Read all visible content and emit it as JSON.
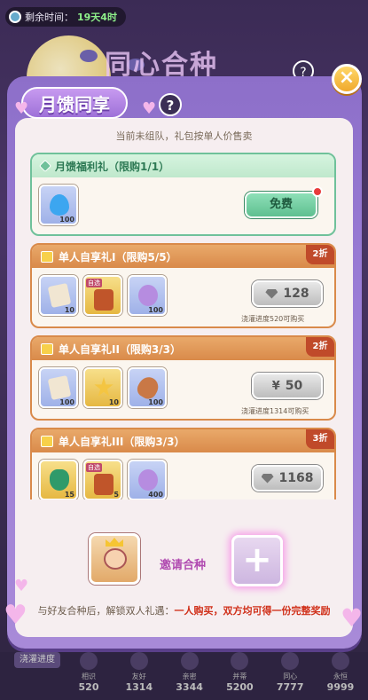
{
  "topbar": {
    "time_label": "剩余时间：",
    "time_value": "19天4时"
  },
  "background": {
    "title": "同心合种",
    "help": "?"
  },
  "dialog": {
    "title": "月馈同享",
    "help": "?",
    "close": "×",
    "notice": "当前未组队，礼包按单人价售卖"
  },
  "packs": [
    {
      "name": "月馈福利礼（限购1/1）",
      "items": [
        {
          "count": "100",
          "icon": "water-drop-icon"
        }
      ],
      "button": "免费"
    },
    {
      "name": "单人自享礼I（限购5/5）",
      "discount": "2折",
      "items": [
        {
          "count": "10",
          "icon": "scroll-icon"
        },
        {
          "count": "",
          "tag": "自选",
          "icon": "chest-icon"
        },
        {
          "count": "100",
          "icon": "mystery-orb-icon"
        }
      ],
      "price": "128",
      "progress": "浇灌进度520可购买"
    },
    {
      "name": "单人自享礼II（限购3/3）",
      "discount": "2折",
      "items": [
        {
          "count": "100",
          "icon": "scroll-icon"
        },
        {
          "count": "10",
          "icon": "star-medal-icon"
        },
        {
          "count": "100",
          "icon": "drumstick-icon"
        }
      ],
      "price": "50",
      "progress": "浇灌进度1314可购买"
    },
    {
      "name": "单人自享礼III（限购3/3）",
      "discount": "3折",
      "items": [
        {
          "count": "15",
          "icon": "green-vase-icon"
        },
        {
          "count": "5",
          "tag": "自选",
          "icon": "chest-icon"
        },
        {
          "count": "400",
          "icon": "mystery-orb-icon"
        }
      ],
      "price": "1168"
    }
  ],
  "invite": {
    "label": "邀请合种",
    "plus": "+"
  },
  "footer": {
    "prefix": "与好友合种后，解锁双人礼遇：",
    "highlight": "一人购买，双方均可得一份完整奖励"
  },
  "bottom": {
    "label": "浇灌进度",
    "nodes": [
      {
        "name": "相识",
        "value": "520"
      },
      {
        "name": "友好",
        "value": "1314"
      },
      {
        "name": "亲密",
        "value": "3344"
      },
      {
        "name": "并蒂",
        "value": "5200"
      },
      {
        "name": "同心",
        "value": "7777"
      },
      {
        "name": "永恒",
        "value": "9999"
      }
    ]
  }
}
